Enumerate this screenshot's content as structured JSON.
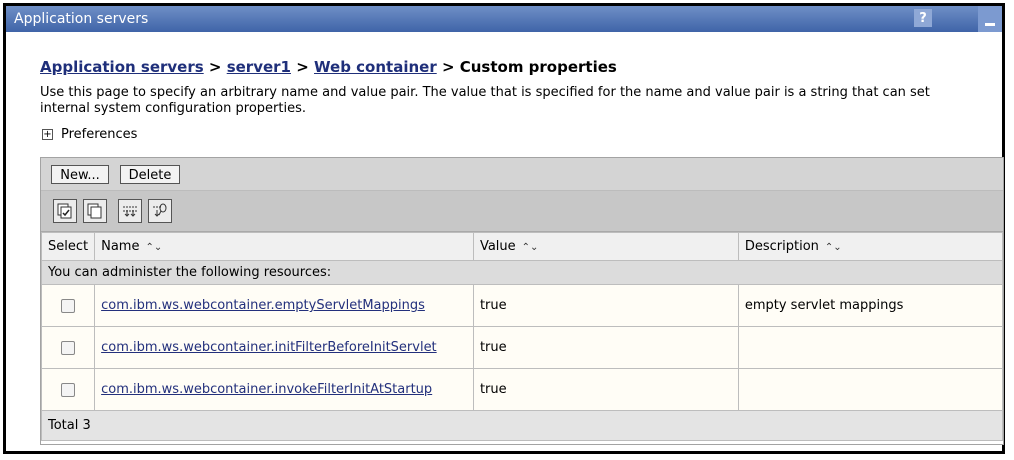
{
  "window": {
    "title": "Application servers",
    "help": "?"
  },
  "breadcrumb": {
    "items": [
      "Application servers",
      "server1",
      "Web container"
    ],
    "separator": " > ",
    "current": "Custom properties"
  },
  "description": "Use this page to specify an arbitrary name and value pair. The value that is specified for the name and value pair is a string that can set internal system configuration properties.",
  "preferences": {
    "label": "Preferences"
  },
  "toolbar": {
    "new_label": "New...",
    "delete_label": "Delete"
  },
  "icon_toolbar": [
    "select-all-icon",
    "deselect-all-icon",
    "show-filter-icon",
    "clear-filter-icon"
  ],
  "table": {
    "columns": [
      "Select",
      "Name",
      "Value",
      "Description"
    ],
    "note": "You can administer the following resources:",
    "rows": [
      {
        "name": "com.ibm.ws.webcontainer.emptyServletMappings",
        "value": "true",
        "description": "empty servlet mappings"
      },
      {
        "name": "com.ibm.ws.webcontainer.initFilterBeforeInitServlet",
        "value": "true",
        "description": ""
      },
      {
        "name": "com.ibm.ws.webcontainer.invokeFilterInitAtStartup",
        "value": "true",
        "description": ""
      }
    ],
    "total": "Total 3"
  },
  "colors": {
    "title_bar": "#4b6fb0",
    "link": "#1f2f7a",
    "row_bg": "#fffdf6"
  }
}
